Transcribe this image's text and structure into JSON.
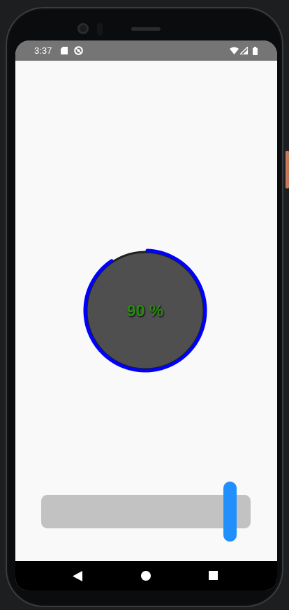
{
  "status_bar": {
    "time": "3:37",
    "left_icons": [
      "sd-card-icon",
      "no-disturb-icon"
    ],
    "right_icons": [
      "wifi-icon",
      "signal-icon",
      "battery-icon"
    ]
  },
  "gauge": {
    "percent": 90,
    "label": "90 %",
    "arc_color": "#0000ff",
    "fill_color": "#4f4f4f",
    "text_color": "#2a8a12"
  },
  "slider": {
    "value": 0.9,
    "track_color": "#c2c2c2",
    "thumb_color": "#2190fc"
  },
  "nav_bar": {
    "buttons": [
      "back-icon",
      "home-icon",
      "recents-icon"
    ]
  }
}
